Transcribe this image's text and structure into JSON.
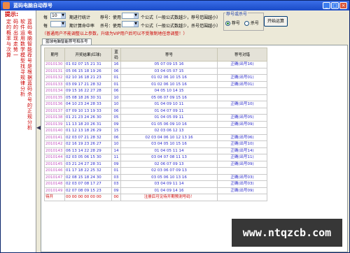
{
  "window": {
    "title": "蓝码电脑自动荐号"
  },
  "left_panel": {
    "heading": "提示:",
    "columns": [
      "蓝码电脑智能荐号是根据蓝码杀号的正规分析",
      "软件运用数学模型找寻规律分析",
      "码的出现走势一",
      "定的概率与次算",
      "科学分析推荐出",
      "概率较高的候选",
      "号码供用户参考"
    ]
  },
  "controls": {
    "row1": {
      "label_a": "每",
      "select_a": "10",
      "label_b": "期进行统计",
      "label_c": "荐号：使用",
      "select_b": "",
      "label_d": "个公式（一般公式数越少，荐号范围越小）"
    },
    "row2": {
      "label_a": "每",
      "select_a": "",
      "label_b": "期计算命中率",
      "label_c": "杀号：使用",
      "select_b": "",
      "label_d": "个公式（一般公式数越少，杀号范围越小）"
    },
    "group_title": "荐号或杀号",
    "radio_recommend": "荐号",
    "radio_kill": "杀号",
    "start_button": "开始运算",
    "notice": "（普通用户不能调整以上参数，升级为VIP用户后可以不受限制地任意调整！）"
  },
  "tab": {
    "label": "蓝球电脑智能荐号和杀号"
  },
  "table": {
    "headers": [
      "期号",
      "开奖结果(红球)",
      "蓝码",
      "荐号",
      "荐号对错"
    ],
    "rows": [
      {
        "period": "2010130",
        "result": "01 02 07 15 21 31",
        "blue": "16",
        "rec": "05 07 09 15 16",
        "verdict": "正确(出号16)"
      },
      {
        "period": "2010131",
        "result": "05 06 15 18 19 26",
        "blue": "06",
        "rec": "03 04 05 07 15",
        "verdict": ""
      },
      {
        "period": "2010132",
        "result": "02 10 16 18 21 23",
        "blue": "01",
        "rec": "01 02 06 10 15 16",
        "verdict": "正确(出号01)"
      },
      {
        "period": "2010133",
        "result": "03 09 17 21 28 32",
        "blue": "01",
        "rec": "01 02 06 10 15 16",
        "verdict": "正确(出号01)"
      },
      {
        "period": "2010134",
        "result": "09 15 16 22 27 28",
        "blue": "06",
        "rec": "04 05 10 14 15",
        "verdict": ""
      },
      {
        "period": "2010135",
        "result": "05 08 18 26 30 31",
        "blue": "10",
        "rec": "05 06 07 09 15 16",
        "verdict": ""
      },
      {
        "period": "2010136",
        "result": "04 10 23 24 28 33",
        "blue": "10",
        "rec": "01 04 09 10 11",
        "verdict": "正确(出号10)"
      },
      {
        "period": "2010137",
        "result": "07 09 10 13 19 33",
        "blue": "06",
        "rec": "01 04 07 09 11",
        "verdict": ""
      },
      {
        "period": "2010138",
        "result": "01 21 23 24 26 30",
        "blue": "05",
        "rec": "01 04 05 09 11",
        "verdict": "正确(出号05)"
      },
      {
        "period": "2010139",
        "result": "11 13 18 20 26 31",
        "blue": "09",
        "rec": "01 05 06 09 10 16",
        "verdict": "正确(出号09)"
      },
      {
        "period": "2010140",
        "result": "01 12 13 18 26 29",
        "blue": "15",
        "rec": "02 03 06 12 13",
        "verdict": ""
      },
      {
        "period": "2010141",
        "result": "02 03 07 21 28 32",
        "blue": "06",
        "rec": "02 03 04 06 10 12 13 16",
        "verdict": "正确(出号06)"
      },
      {
        "period": "2010142",
        "result": "02 16 19 23 26 27",
        "blue": "10",
        "rec": "03 04 05 10 15 16",
        "verdict": "正确(出号10)"
      },
      {
        "period": "2010143",
        "result": "06 13 14 22 28 29",
        "blue": "14",
        "rec": "01 04 05 11 14",
        "verdict": "正确(出号14)"
      },
      {
        "period": "2010144",
        "result": "02 03 05 06 15 30",
        "blue": "11",
        "rec": "03 04 07 08 11 13",
        "verdict": "正确(出号11)"
      },
      {
        "period": "2010145",
        "result": "03 21 24 27 28 31",
        "blue": "09",
        "rec": "02 06 07 09 13",
        "verdict": "正确(出号09)"
      },
      {
        "period": "2010146",
        "result": "01 17 18 22 25 32",
        "blue": "01",
        "rec": "02 03 06 07 09 13",
        "verdict": ""
      },
      {
        "period": "2010147",
        "result": "02 08 15 18 24 30",
        "blue": "03",
        "rec": "03 05 06 10 13 16",
        "verdict": "正确(出号03)"
      },
      {
        "period": "2010148",
        "result": "02 03 07 08 17 27",
        "blue": "03",
        "rec": "03 04 09 11 14",
        "verdict": "正确(出号03)"
      },
      {
        "period": "2010149",
        "result": "02 07 08 09 15 23",
        "blue": "09",
        "rec": "01 04 09 14 16",
        "verdict": "正确(出号09)"
      },
      {
        "period": "待开",
        "result": "00 00 00 00 00 00",
        "blue": "00",
        "rec": "注册后可见待开期预测号码！",
        "verdict": ""
      }
    ]
  },
  "watermark": "www.ntqzcb.com"
}
